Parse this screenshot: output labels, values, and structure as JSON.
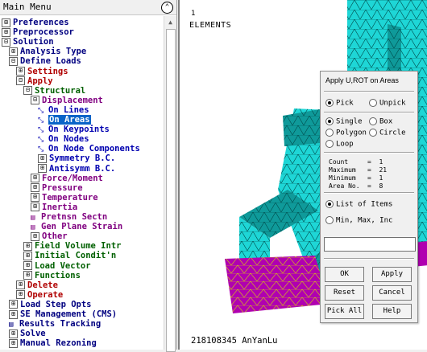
{
  "menu": {
    "title": "Main Menu",
    "collapse_icon": "double-chevron-up-icon",
    "items": [
      {
        "label": "Preferences",
        "level": 0,
        "icon": "expander",
        "exp": "⊞",
        "color": "navy"
      },
      {
        "label": "Preprocessor",
        "level": 0,
        "icon": "expander",
        "exp": "⊞",
        "color": "navy"
      },
      {
        "label": "Solution",
        "level": 0,
        "icon": "expander",
        "exp": "⊟",
        "color": "navy"
      },
      {
        "label": "Analysis Type",
        "level": 1,
        "icon": "expander",
        "exp": "⊞",
        "color": "navy"
      },
      {
        "label": "Define Loads",
        "level": 1,
        "icon": "expander",
        "exp": "⊟",
        "color": "navy"
      },
      {
        "label": "Settings",
        "level": 2,
        "icon": "expander",
        "exp": "⊞",
        "color": "red"
      },
      {
        "label": "Apply",
        "level": 2,
        "icon": "expander",
        "exp": "⊟",
        "color": "red"
      },
      {
        "label": "Structural",
        "level": 3,
        "icon": "expander",
        "exp": "⊟",
        "color": "green"
      },
      {
        "label": "Displacement",
        "level": 4,
        "icon": "expander",
        "exp": "⊟",
        "color": "purple"
      },
      {
        "label": "On Lines",
        "level": 5,
        "icon": "pick",
        "exp": "⤡",
        "color": "blue"
      },
      {
        "label": "On Areas",
        "level": 5,
        "icon": "pick",
        "exp": "⤡",
        "color": "blue",
        "selected": true
      },
      {
        "label": "On Keypoints",
        "level": 5,
        "icon": "pick",
        "exp": "⤡",
        "color": "blue"
      },
      {
        "label": "On Nodes",
        "level": 5,
        "icon": "pick",
        "exp": "⤡",
        "color": "blue"
      },
      {
        "label": "On Node Components",
        "level": 5,
        "icon": "pick",
        "exp": "⤡",
        "color": "blue"
      },
      {
        "label": "Symmetry B.C.",
        "level": 5,
        "icon": "expander",
        "exp": "⊞",
        "color": "blue"
      },
      {
        "label": "Antisymm B.C.",
        "level": 5,
        "icon": "expander",
        "exp": "⊞",
        "color": "blue"
      },
      {
        "label": "Force/Moment",
        "level": 4,
        "icon": "expander",
        "exp": "⊞",
        "color": "purple"
      },
      {
        "label": "Pressure",
        "level": 4,
        "icon": "expander",
        "exp": "⊞",
        "color": "purple"
      },
      {
        "label": "Temperature",
        "level": 4,
        "icon": "expander",
        "exp": "⊞",
        "color": "purple"
      },
      {
        "label": "Inertia",
        "level": 4,
        "icon": "expander",
        "exp": "⊞",
        "color": "purple"
      },
      {
        "label": "Pretnsn Sectn",
        "level": 4,
        "icon": "dialog",
        "exp": "▤",
        "color": "purple"
      },
      {
        "label": "Gen Plane Strain",
        "level": 4,
        "icon": "dialog",
        "exp": "▤",
        "color": "purple"
      },
      {
        "label": "Other",
        "level": 4,
        "icon": "expander",
        "exp": "⊞",
        "color": "purple"
      },
      {
        "label": "Field Volume Intr",
        "level": 3,
        "icon": "expander",
        "exp": "⊞",
        "color": "green"
      },
      {
        "label": "Initial Condit'n",
        "level": 3,
        "icon": "expander",
        "exp": "⊞",
        "color": "green"
      },
      {
        "label": "Load Vector",
        "level": 3,
        "icon": "expander",
        "exp": "⊞",
        "color": "green"
      },
      {
        "label": "Functions",
        "level": 3,
        "icon": "expander",
        "exp": "⊞",
        "color": "green"
      },
      {
        "label": "Delete",
        "level": 2,
        "icon": "expander",
        "exp": "⊞",
        "color": "red"
      },
      {
        "label": "Operate",
        "level": 2,
        "icon": "expander",
        "exp": "⊞",
        "color": "red"
      },
      {
        "label": "Load Step Opts",
        "level": 1,
        "icon": "expander",
        "exp": "⊞",
        "color": "navy"
      },
      {
        "label": "SE Management (CMS)",
        "level": 1,
        "icon": "expander",
        "exp": "⊞",
        "color": "navy"
      },
      {
        "label": "Results Tracking",
        "level": 1,
        "icon": "dialog",
        "exp": "▤",
        "color": "navy"
      },
      {
        "label": "Solve",
        "level": 1,
        "icon": "expander",
        "exp": "⊞",
        "color": "navy"
      },
      {
        "label": "Manual Rezoning",
        "level": 1,
        "icon": "expander",
        "exp": "⊞",
        "color": "navy"
      }
    ]
  },
  "graphics": {
    "cursor_label": "1",
    "plot_title": "ELEMENTS",
    "footer": "218108345 AnYanLu",
    "colors": {
      "mesh_main": "#1ed6d6",
      "mesh_dark": "#0f9a9a",
      "mesh_base": "#b000b0",
      "edge": "#003c3c",
      "highlight": "#e0e000"
    }
  },
  "dialog": {
    "title": "Apply U,ROT on Areas",
    "pick": {
      "pick": "Pick",
      "unpick": "Unpick"
    },
    "mode": {
      "single": "Single",
      "box": "Box",
      "polygon": "Polygon",
      "circle": "Circle",
      "loop": "Loop"
    },
    "info": [
      {
        "label": "Count",
        "value": "1"
      },
      {
        "label": "Maximum",
        "value": "21"
      },
      {
        "label": "Minimum",
        "value": "1"
      },
      {
        "label": "Area No.",
        "value": "8"
      }
    ],
    "list_mode": {
      "list": "List of Items",
      "range": "Min, Max, Inc"
    },
    "input_value": "",
    "buttons": {
      "ok": "OK",
      "apply": "Apply",
      "reset": "Reset",
      "cancel": "Cancel",
      "pick_all": "Pick All",
      "help": "Help"
    }
  }
}
